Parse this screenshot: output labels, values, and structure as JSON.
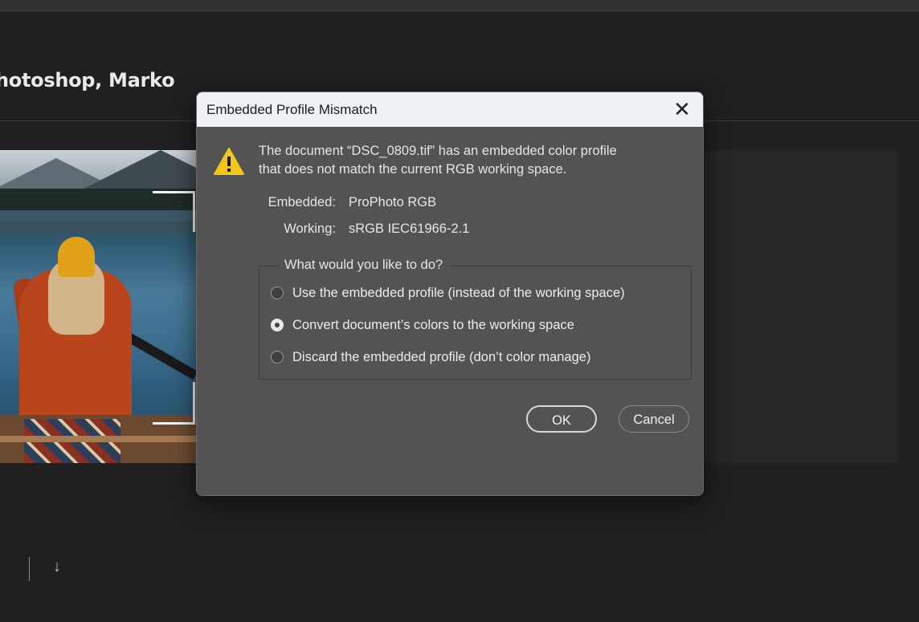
{
  "background": {
    "welcome_text": "hotoshop, Marko"
  },
  "dialog": {
    "title": "Embedded Profile Mismatch",
    "message_line1": "The document “DSC_0809.tif” has an embedded color profile",
    "message_line2": "that does not match the current RGB working space.",
    "embedded_label": "Embedded:",
    "embedded_value": "ProPhoto RGB",
    "working_label": "Working:",
    "working_value": "sRGB IEC61966-2.1",
    "group_legend": "What would you like to do?",
    "options": [
      {
        "label": "Use the embedded profile (instead of the working space)",
        "selected": false
      },
      {
        "label": "Convert document’s colors to the working space",
        "selected": true
      },
      {
        "label": "Discard the embedded profile (don’t color manage)",
        "selected": false
      }
    ],
    "ok_label": "OK",
    "cancel_label": "Cancel"
  },
  "colors": {
    "dialog_bg": "#535353",
    "titlebar_bg": "#eef2f7",
    "warning_yellow": "#f5c518"
  },
  "icons": [
    "warning-icon",
    "close-icon",
    "download-icon"
  ]
}
